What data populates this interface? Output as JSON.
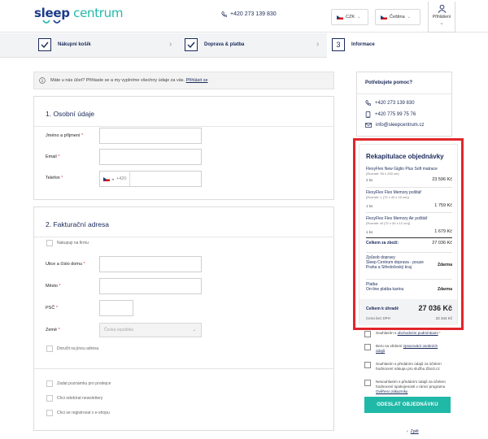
{
  "header": {
    "logo_part1": "sleep",
    "logo_part2": "centrum",
    "phone": "+420 273 139 830",
    "currency": "CZK",
    "language": "Čeština",
    "login": "Přihlášení"
  },
  "steps": [
    {
      "number": "",
      "label": "Nákupní košík"
    },
    {
      "number": "",
      "label": "Doprava & platba"
    },
    {
      "number": "3",
      "label": "Informace"
    }
  ],
  "info": {
    "text": "Máte u nás účet? Přihlaste se a my vyplníme všechny údaje za vás.",
    "link": "Přihlásit se"
  },
  "personal": {
    "title": "1. Osobní údaje",
    "name_label": "Jméno a příjmení",
    "email_label": "Email",
    "phone_label": "Telefon",
    "phone_prefix": "+420",
    "required_mark": "*"
  },
  "billing": {
    "title": "2. Fakturační adresa",
    "company_checkbox": "Nakupuji na firmu",
    "street_label": "Ulice a číslo domu",
    "city_label": "Město",
    "zip_label": "PSČ",
    "country_label": "Země",
    "country_placeholder": "Česká republika",
    "other_address": "Doručit na jinou adresu",
    "password_checkbox": "Zadat poznámku pro prodejce",
    "newsletter_checkbox": "Chci odebírat newslettery",
    "register_checkbox": "Chci se registrovat v e-shopu"
  },
  "help": {
    "title": "Potřebujete pomoc?",
    "phone1": "+420 273 139 830",
    "phone2": "+420 775 99 75 76",
    "email": "info@sleepcentrum.cz"
  },
  "summary": {
    "title": "Rekapitulace objednávky",
    "items": [
      {
        "name": "FlexyFlex New Giglio Plus Soft matrace",
        "size": "(Rozměr: 90 x 200 cm)",
        "qty": "2 ks",
        "price": "23 596 Kč"
      },
      {
        "name": "FlexyFlex Flex Memory polštář",
        "size": "(Rozměr: L (72 x 40 x 15 cm))",
        "qty": "1 ks",
        "price": "1 759 Kč"
      },
      {
        "name": "FlexyFlex Flex Memory Air polštář",
        "size": "(Rozměr: M (72 x 40 x 12 cm))",
        "qty": "1 ks",
        "price": "1 679 Kč"
      }
    ],
    "goods_total_label": "Celkem za zboží:",
    "goods_total": "27 036 Kč",
    "shipping_label": "Způsob dopravy",
    "shipping_value": "Sleep Centrum doprava - pouze Praha a Středočeský kraj",
    "shipping_price": "Zdarma",
    "payment_label": "Platba",
    "payment_value": "On-line platba kartou",
    "payment_price": "Zdarma",
    "total_label": "Celkem k úhradě",
    "total": "27 036 Kč",
    "vat_label": "Cena bez DPH",
    "vat_value": "22 344 Kč"
  },
  "consents": [
    {
      "pre": "Souhlasím s ",
      "link": "obchodními podmínkami",
      "post": " *"
    },
    {
      "pre": "Beru na vědomí ",
      "link": "zpracování osobních údajů",
      "post": ""
    },
    {
      "pre": "Souhlasím s předáním údajů za účelem hodnocení nákupu pro službu Zbozi.cz",
      "link": "",
      "post": ""
    },
    {
      "pre": "Nesouhlasím s předáním údajů za účelem hodnocení spokojenosti v rámci programu ",
      "link": "Ověřeno zákazníky",
      "post": ""
    }
  ],
  "submit_button": "ODESLAT OBJEDNÁVKU",
  "back": {
    "arrow": "‹",
    "label": "Zpět"
  }
}
